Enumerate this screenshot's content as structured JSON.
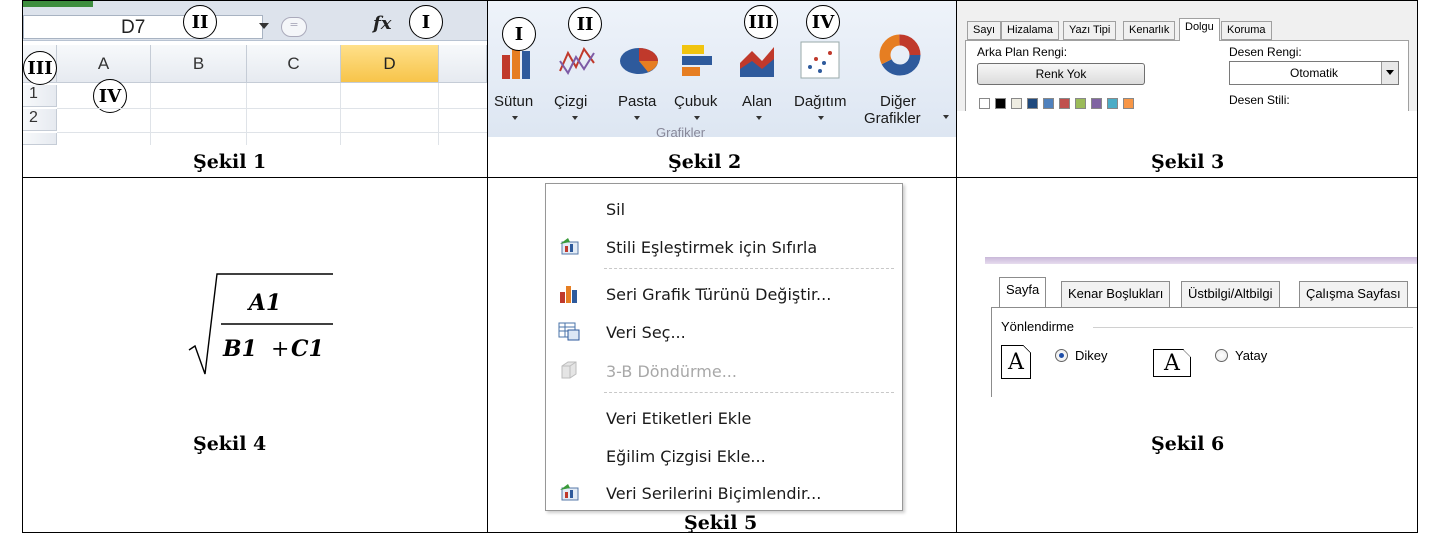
{
  "sekil1": {
    "caption": "Şekil 1",
    "name_box": "D7",
    "formula_icon": "fx",
    "columns": [
      "A",
      "B",
      "C",
      "D"
    ],
    "selected_column": "D",
    "rows": [
      "1",
      "2"
    ],
    "markers": [
      "II",
      "I",
      "III",
      "IV"
    ]
  },
  "sekil2": {
    "caption": "Şekil 2",
    "buttons": [
      "Sütun",
      "Çizgi",
      "Pasta",
      "Çubuk",
      "Alan",
      "Dağıtım"
    ],
    "other_line1": "Diğer",
    "other_line2": "Grafikler",
    "group_label": "Grafikler",
    "markers": [
      "I",
      "II",
      "III",
      "IV"
    ]
  },
  "sekil3": {
    "caption": "Şekil 3",
    "tabs": [
      "Sayı",
      "Hizalama",
      "Yazı Tipi",
      "Kenarlık",
      "Dolgu",
      "Koruma"
    ],
    "active_tab": "Dolgu",
    "bg_color_label": "Arka Plan Rengi:",
    "no_color_button": "Renk Yok",
    "pattern_color_label": "Desen Rengi:",
    "pattern_color_value": "Otomatik",
    "pattern_style_label": "Desen Stili:",
    "swatch_colors": [
      "#ffffff",
      "#000000",
      "#eeece1",
      "#1f497d",
      "#4f81bd",
      "#c0504d",
      "#9bbb59",
      "#8064a2",
      "#4bacc6",
      "#f79646"
    ]
  },
  "sekil4": {
    "caption": "Şekil 4",
    "numerator": "A1",
    "denominator_a": "B1",
    "plus": "+",
    "denominator_b": "C1"
  },
  "sekil5": {
    "caption": "Şekil 5",
    "menu_items": [
      {
        "label": "Sil",
        "icon": "none",
        "disabled": false
      },
      {
        "label": "Stili Eşleştirmek için Sıfırla",
        "icon": "reset-style-icon",
        "disabled": false
      },
      {
        "label": "Seri Grafik Türünü Değiştir...",
        "icon": "chart-type-icon",
        "disabled": false
      },
      {
        "label": "Veri Seç...",
        "icon": "select-data-icon",
        "disabled": false
      },
      {
        "label": "3-B Döndürme...",
        "icon": "rotate-3d-icon",
        "disabled": true
      },
      {
        "label": "Veri Etiketleri Ekle",
        "icon": "none",
        "disabled": false
      },
      {
        "label": "Eğilim Çizgisi Ekle...",
        "icon": "none",
        "disabled": false
      },
      {
        "label": "Veri Serilerini Biçimlendir...",
        "icon": "format-series-icon",
        "disabled": false
      }
    ]
  },
  "sekil6": {
    "caption": "Şekil 6",
    "tabs": [
      "Sayfa",
      "Kenar Boşlukları",
      "Üstbilgi/Altbilgi",
      "Çalışma Sayfası"
    ],
    "active_tab": "Sayfa",
    "orientation_label": "Yönlendirme",
    "portrait_label": "Dikey",
    "landscape_label": "Yatay",
    "selected_orientation": "Dikey",
    "page_icon_letter": "A"
  }
}
